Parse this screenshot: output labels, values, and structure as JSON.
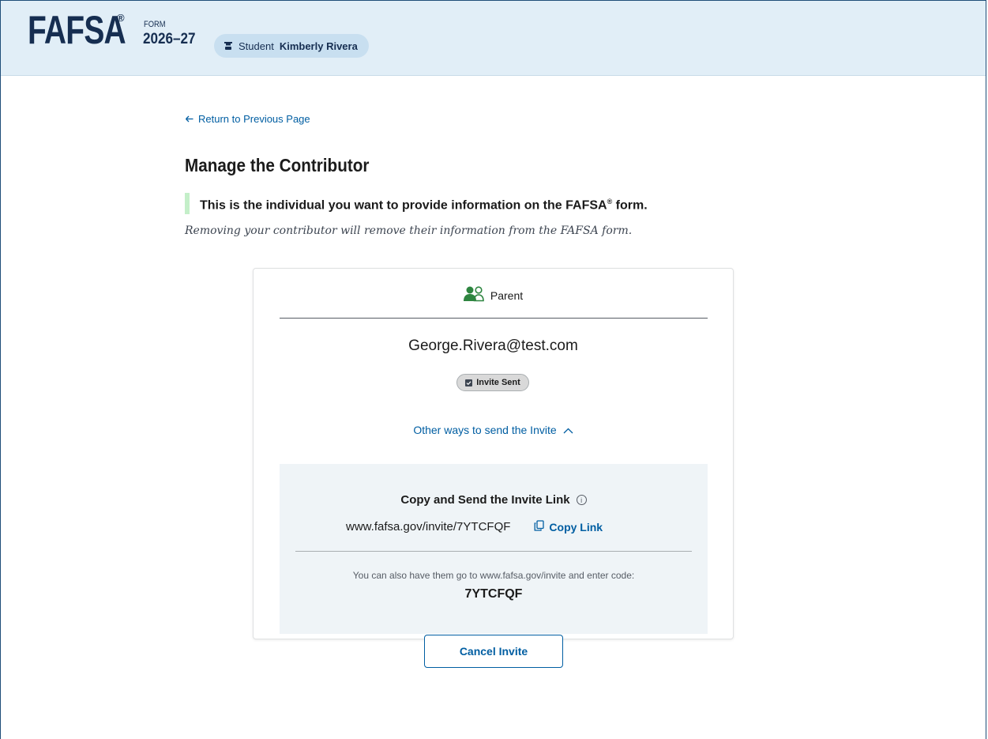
{
  "header": {
    "logo": "FAFSA",
    "registered": "®",
    "form_label": "FORM",
    "form_year": "2026–27",
    "student_prefix": "Student",
    "student_name": "Kimberly Rivera"
  },
  "nav": {
    "back_link": "Return to Previous Page"
  },
  "main": {
    "title": "Manage the Contributor",
    "lead_text": "This is the individual you want to provide information on the FAFSA",
    "lead_reg": "®",
    "lead_suffix": " form.",
    "note": "Removing your contributor will remove their information from the FAFSA form."
  },
  "card": {
    "role": "Parent",
    "email": "George.Rivera@test.com",
    "status": "Invite Sent",
    "other_ways": "Other ways to send the Invite",
    "invite": {
      "title": "Copy and Send the Invite Link",
      "info_icon": "ⓘ",
      "url": "www.fafsa.gov/invite/7YTCFQF",
      "copy_label": "Copy Link",
      "also_text": "You can also have them go to www.fafsa.gov/invite and enter code:",
      "code": "7YTCFQF"
    },
    "cancel_label": "Cancel Invite"
  },
  "colors": {
    "header_bg": "#e1eef7",
    "brand_navy": "#162e51",
    "link_blue": "#005ea2",
    "parent_icon_green": "#2e8540",
    "lead_border_green": "#c4efc9",
    "panel_bg": "#eff4f7"
  },
  "icons": {
    "back": "arrow-left-icon",
    "student": "student-icon",
    "role": "parent-people-icon",
    "status": "checkbox-checked-icon",
    "other_ways": "chevron-up-icon",
    "info": "info-icon",
    "copy": "copy-icon"
  }
}
